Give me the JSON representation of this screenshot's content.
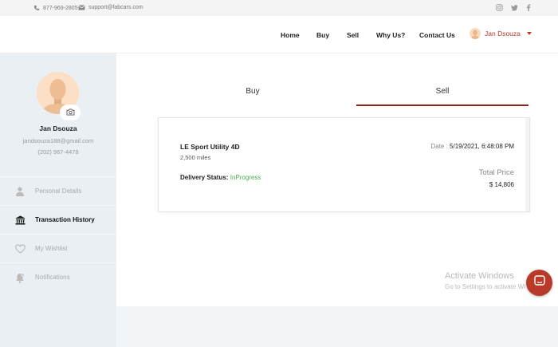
{
  "topbar": {
    "phone": "877-969-2805",
    "email": "support@fabcars.com",
    "social_icons": [
      "instagram-icon",
      "twitter-icon",
      "facebook-icon"
    ]
  },
  "nav": {
    "home": "Home",
    "buy": "Buy",
    "sell": "Sell",
    "why_us": "Why Us?",
    "contact_us": "Contact Us",
    "user_name": "Jan Dsouza"
  },
  "profile": {
    "name": "Jan Dsouza",
    "email": "jandsouza188@gmail.com",
    "phone": "(202) 967-4478"
  },
  "sidebar": {
    "items": [
      {
        "label": "Personal Details",
        "icon": "user-icon",
        "active": false
      },
      {
        "label": "Transaction History",
        "icon": "bank-icon",
        "active": true
      },
      {
        "label": "My Wishlist",
        "icon": "heart-icon",
        "active": false
      },
      {
        "label": "Notifications",
        "icon": "bell-icon",
        "active": false
      }
    ]
  },
  "tabs": {
    "buy": "Buy",
    "sell": "Sell",
    "active": "Sell"
  },
  "transaction": {
    "vehicle": "LE Sport Utility 4D",
    "miles": "2,500 miles",
    "delivery_label": "Delivery Status:",
    "delivery_status": "InProgress",
    "date_label": "Date : ",
    "date_value": "5/19/2021, 6:48:08 PM",
    "total_label": "Total Price",
    "total_value": "$ 14,806"
  },
  "watermark": {
    "line1": "Activate Windows",
    "line2": "Go to Settings to activate Wi"
  },
  "colors": {
    "accent": "#8b2720",
    "user_name": "#b33a2e",
    "status_green": "#4caf50",
    "chat_button": "#b83a29"
  }
}
